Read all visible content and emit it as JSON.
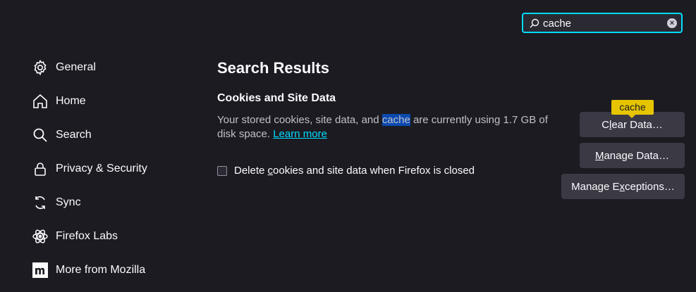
{
  "search": {
    "value": "cache"
  },
  "sidebar": {
    "items": [
      {
        "label": "General",
        "icon": "gear-icon"
      },
      {
        "label": "Home",
        "icon": "home-icon"
      },
      {
        "label": "Search",
        "icon": "search-icon"
      },
      {
        "label": "Privacy & Security",
        "icon": "lock-icon"
      },
      {
        "label": "Sync",
        "icon": "sync-icon"
      },
      {
        "label": "Firefox Labs",
        "icon": "atom-icon"
      },
      {
        "label": "More from Mozilla",
        "icon": "mozilla-logo-icon"
      }
    ]
  },
  "main": {
    "title": "Search Results",
    "section_title": "Cookies and Site Data",
    "desc_before": "Your stored cookies, site data, and ",
    "desc_highlight": "cache",
    "desc_after": " are currently using 1.7 GB of disk space. ",
    "learn_more": "Learn more",
    "checkbox_label_pre": "Delete ",
    "checkbox_label_u": "c",
    "checkbox_label_post": "ookies and site data when Firefox is closed",
    "checkbox_checked": false
  },
  "buttons": {
    "clear_pre": "C",
    "clear_u": "l",
    "clear_post": "ear Data…",
    "manage_pre": "",
    "manage_u": "M",
    "manage_post": "anage Data…",
    "exceptions_pre": "Manage E",
    "exceptions_u": "x",
    "exceptions_post": "ceptions…"
  },
  "tooltip": {
    "text": "cache"
  },
  "colors": {
    "background": "#1c1b22",
    "accent": "#00ddff",
    "highlight": "#0b4ab0",
    "tooltip": "#e6c500"
  }
}
